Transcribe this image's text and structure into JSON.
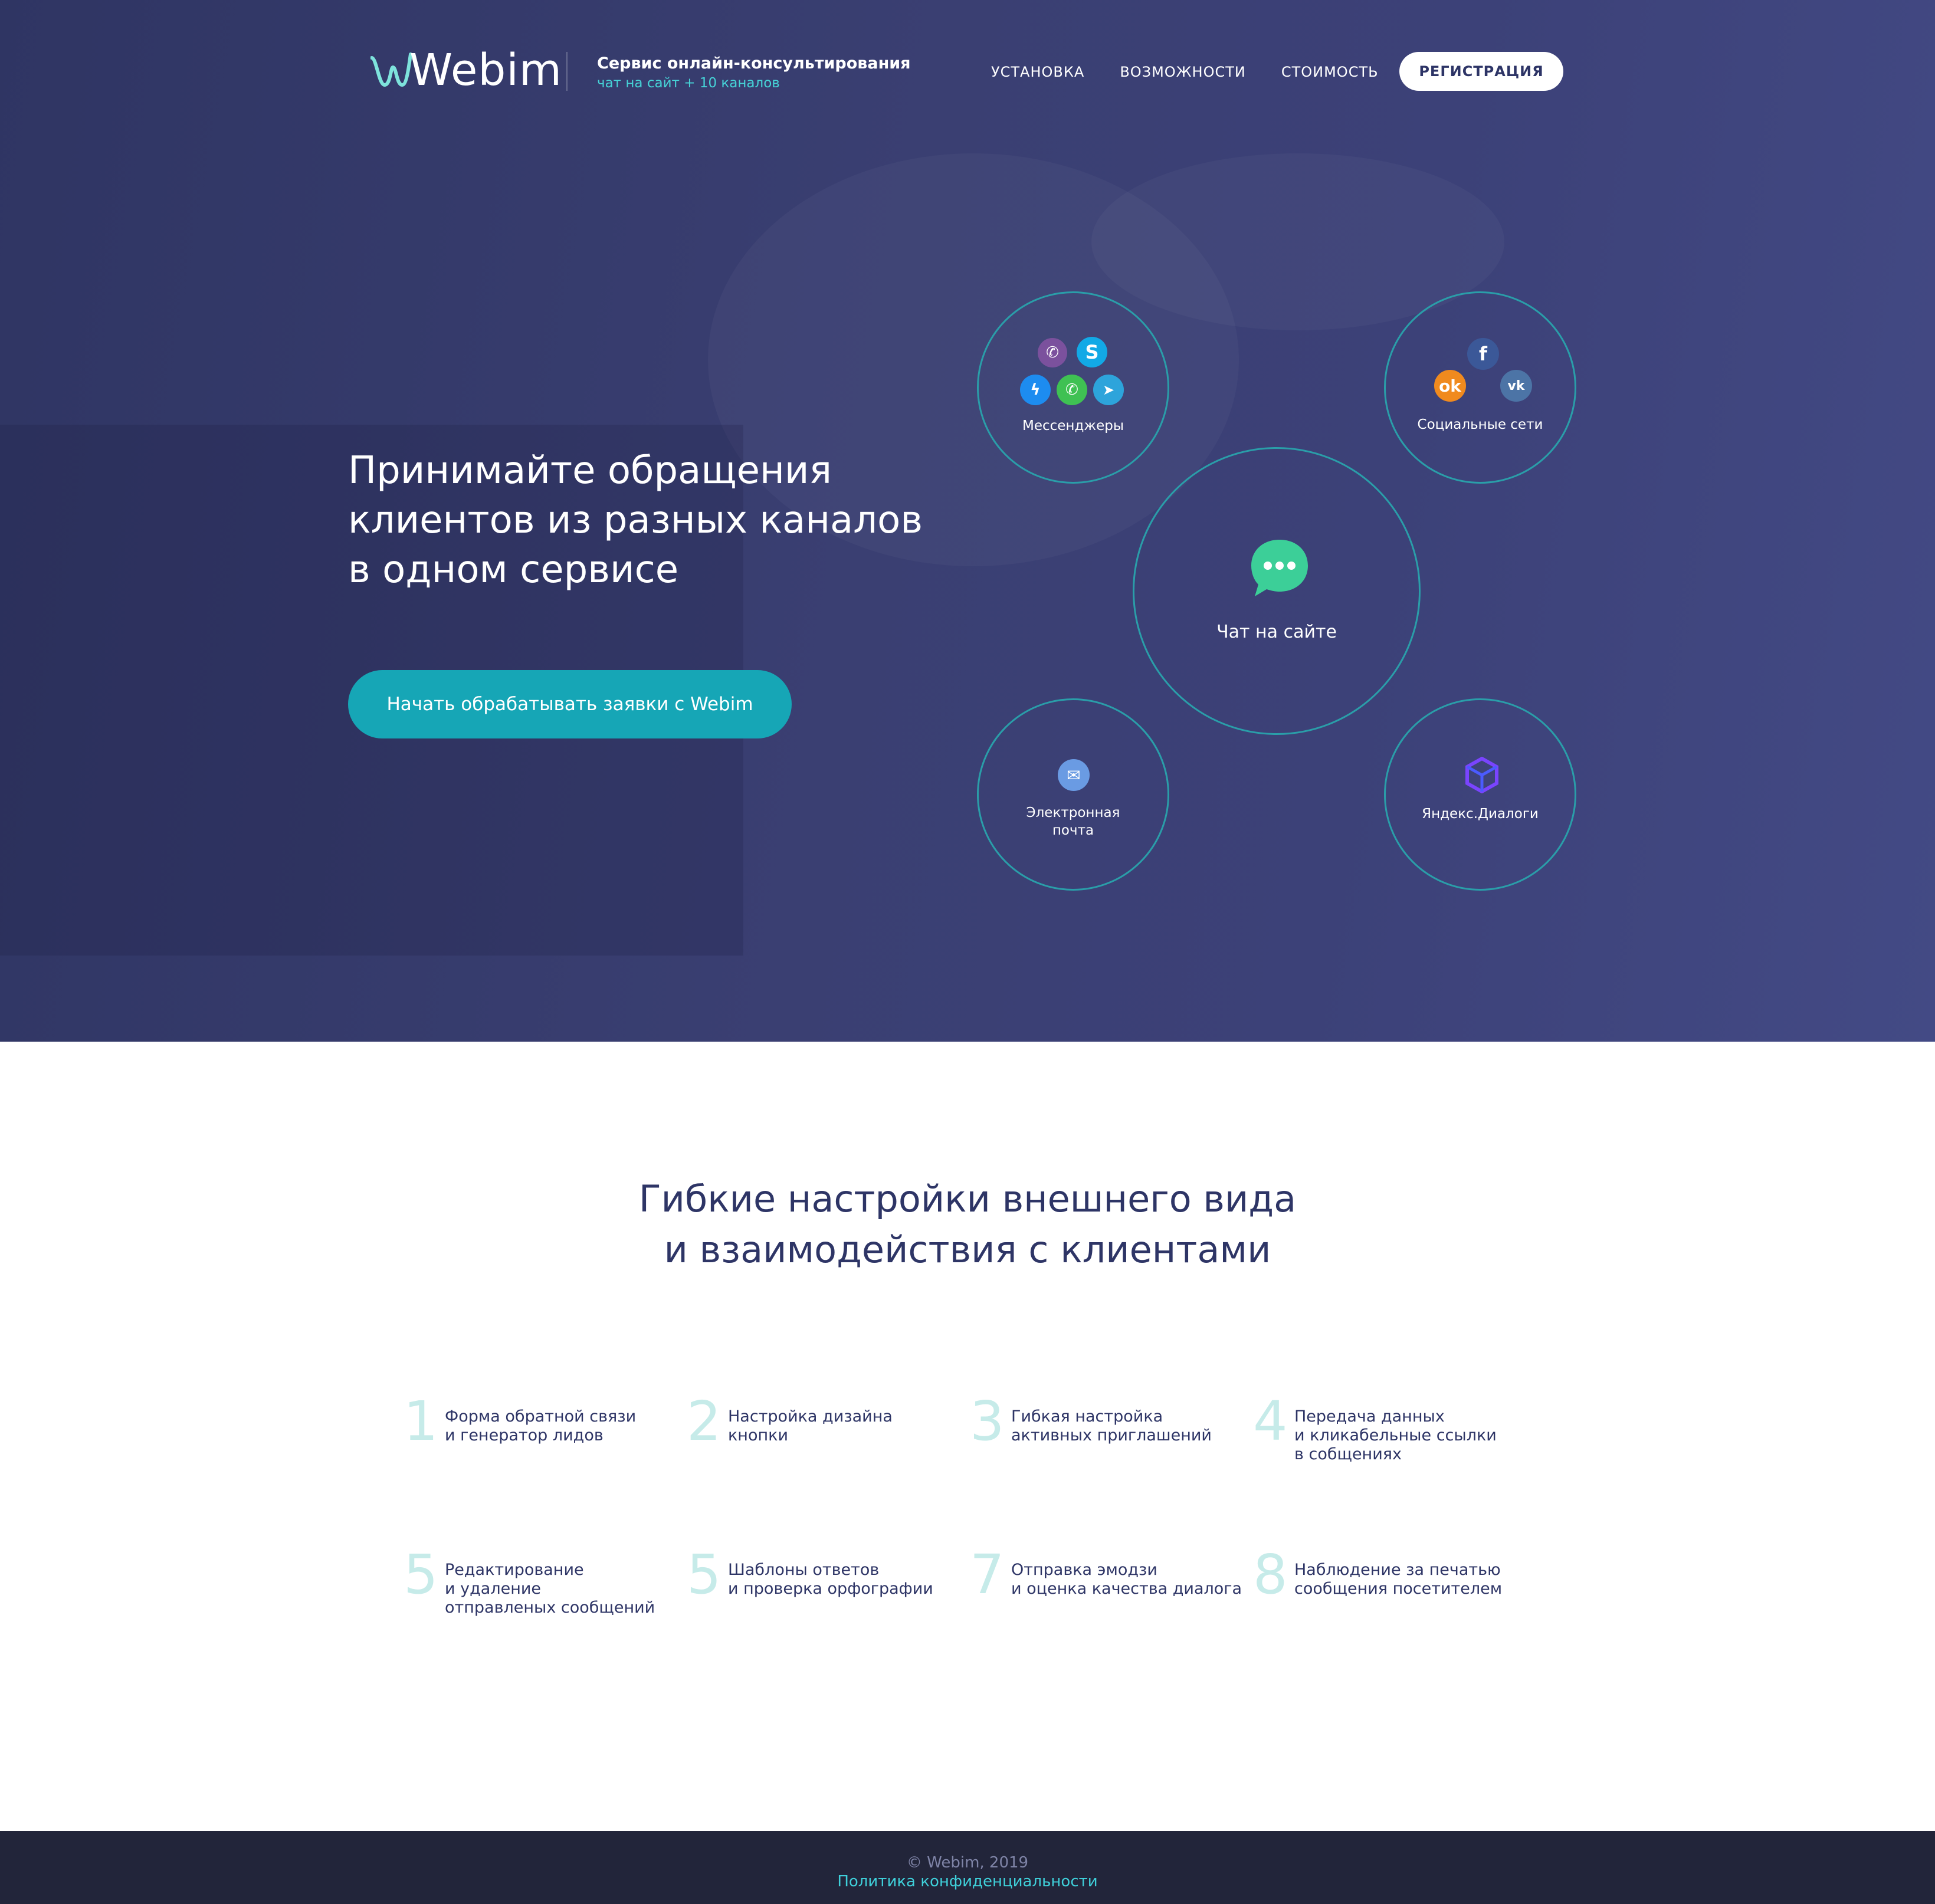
{
  "header": {
    "logo_text": "Webim",
    "tagline_title": "Сервис онлайн-консультирования",
    "tagline_sub": "чат на сайт + 10 каналов",
    "nav": [
      "УСТАНОВКА",
      "ВОЗМОЖНОСТИ",
      "СТОИМОСТЬ"
    ],
    "register_label": "РЕГИСТРАЦИЯ"
  },
  "hero": {
    "headline": "Принимайте обращения клиентов из разных каналов в одном сервисе",
    "cta_label": "Начать обрабатывать заявки с Webim",
    "channels": {
      "messengers": "Мессенджеры",
      "social": "Социальные сети",
      "site_chat": "Чат на сайте",
      "email": "Электронная\nпочта",
      "yandex": "Яндекс.Диалоги"
    },
    "icons": {
      "messengers": [
        "viber-icon",
        "skype-icon",
        "messenger-icon",
        "whatsapp-icon",
        "telegram-icon"
      ],
      "social": [
        "facebook-icon",
        "odnoklassniki-icon",
        "vk-icon"
      ],
      "site_chat": "chat-bubble-icon",
      "email": "envelope-icon",
      "yandex": "yandex-dialogs-icon"
    }
  },
  "features": {
    "title_line1": "Гибкие настройки внешнего вида",
    "title_line2": "и взаимодействия с клиентами",
    "items": [
      {
        "num": "1",
        "text": "Форма обратной связи\nи генератор лидов"
      },
      {
        "num": "2",
        "text": "Настройка дизайна\nкнопки"
      },
      {
        "num": "3",
        "text": "Гибкая настройка\nактивных приглашений"
      },
      {
        "num": "4",
        "text": "Передача данных\nи кликабельные ссылки\nв собщениях"
      },
      {
        "num": "5",
        "text": "Редактирование\nи удаление\nотправленых сообщений"
      },
      {
        "num": "5",
        "text": "Шаблоны ответов\nи проверка орфографии"
      },
      {
        "num": "7",
        "text": "Отправка эмодзи\nи оценка качества диалога"
      },
      {
        "num": "8",
        "text": "Наблюдение за печатью\nсообщения посетителем"
      }
    ]
  },
  "footer": {
    "copyright": "© Webim, 2019",
    "policy": "Политика конфиденциальности"
  },
  "colors": {
    "hero_bg": "#3a3f72",
    "accent_teal": "#16a6b6",
    "circle_border": "#2a9ea9",
    "dark_text": "#2e3566",
    "number_tint": "#c6ebe9",
    "footer_bg": "#22253a"
  }
}
